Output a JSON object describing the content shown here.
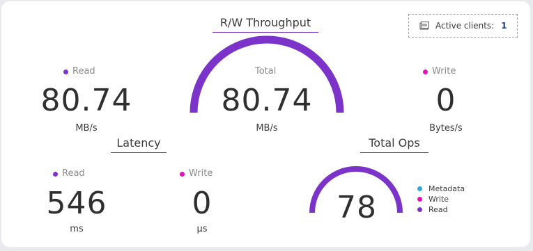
{
  "active_clients": {
    "label": "Active clients:",
    "count": "1",
    "icon": "stack-icon"
  },
  "throughput": {
    "title": "R/W Throughput",
    "read": {
      "label": "Read",
      "value": "80.74",
      "unit": "MB/s"
    },
    "total": {
      "label": "Total",
      "value": "80.74",
      "unit": "MB/s"
    },
    "write": {
      "label": "Write",
      "value": "0",
      "unit": "Bytes/s"
    },
    "gauge_fill": 1.0
  },
  "latency": {
    "title": "Latency",
    "read": {
      "label": "Read",
      "value": "546",
      "unit": "ms"
    },
    "write": {
      "label": "Write",
      "value": "0",
      "unit": "µs"
    }
  },
  "total_ops": {
    "title": "Total Ops",
    "value": "78",
    "gauge_fill": 1.0,
    "legend": [
      {
        "label": "Metadata",
        "color": "#2fa7d8"
      },
      {
        "label": "Write",
        "color": "#e212b8"
      },
      {
        "label": "Read",
        "color": "#7b33c9"
      }
    ]
  },
  "colors": {
    "read": "#7b33c9",
    "write": "#e212b8",
    "metadata": "#2fa7d8",
    "gauge_track": "#e6e6ea"
  }
}
